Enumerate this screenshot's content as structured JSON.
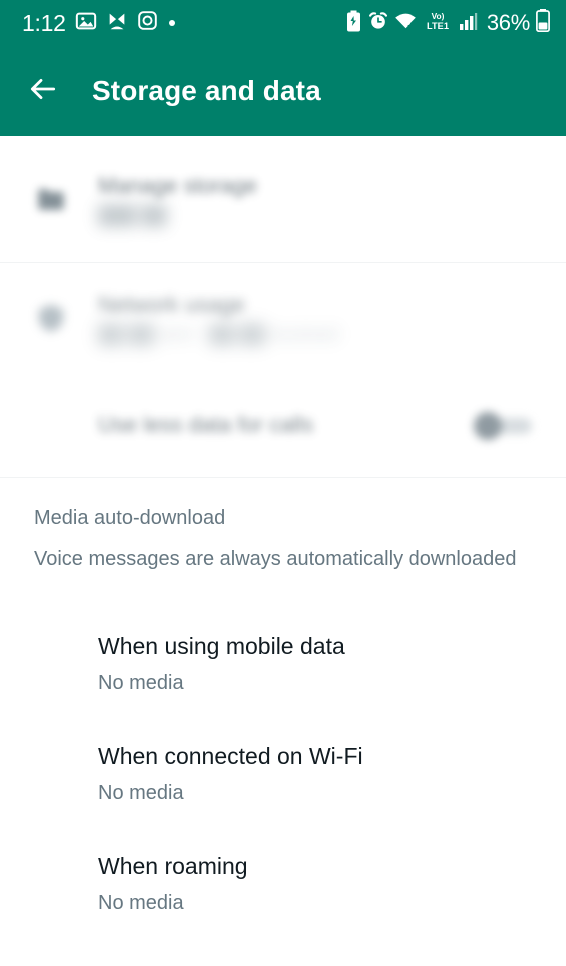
{
  "status_bar": {
    "time": "1:12",
    "battery_percent": "36%",
    "network_label": "VoLTE1",
    "left_icons": [
      "photos-icon",
      "mms-contact-icon",
      "instagram-icon",
      "dot-indicator-icon"
    ],
    "right_icons": [
      "battery-saver-icon",
      "alarm-icon",
      "wifi-icon",
      "volte-icon",
      "signal-bars-icon",
      "battery-icon"
    ]
  },
  "app_bar": {
    "back_icon": "back-arrow-icon",
    "title": "Storage and data"
  },
  "settings_rows": [
    {
      "icon": "folder-storage-icon",
      "title": "Manage storage",
      "subtitle": "███ ██",
      "redacted": true
    },
    {
      "icon": "network-usage-icon",
      "title": "Network usage",
      "subtitle": "██ ██ sent · ██ ██ received",
      "redacted": true
    }
  ],
  "toggle_row": {
    "title": "Use less data for calls",
    "toggle_name": "use-less-data-for-calls-toggle",
    "toggle_state": "off",
    "redacted": true
  },
  "media_section": {
    "header": "Media auto-download",
    "description": "Voice messages are always automatically downloaded",
    "items": [
      {
        "title": "When using mobile data",
        "value": "No media"
      },
      {
        "title": "When connected on Wi-Fi",
        "value": "No media"
      },
      {
        "title": "When roaming",
        "value": "No media"
      }
    ]
  },
  "colors": {
    "header_green": "#00806a",
    "title_text": "#111b21",
    "secondary_text": "#667781",
    "divider": "#f1f3f4",
    "background": "#ffffff"
  }
}
